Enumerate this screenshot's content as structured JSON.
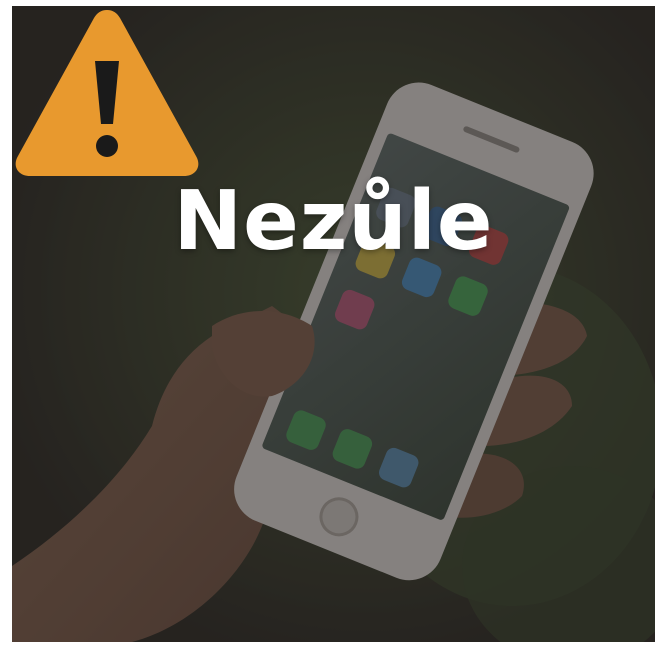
{
  "headline": "Nezůle",
  "colors": {
    "warning_fill": "#E8992E",
    "warning_mark": "#1a1a1a",
    "headline_text": "#ffffff"
  },
  "icons": [
    "warning-triangle-icon"
  ]
}
